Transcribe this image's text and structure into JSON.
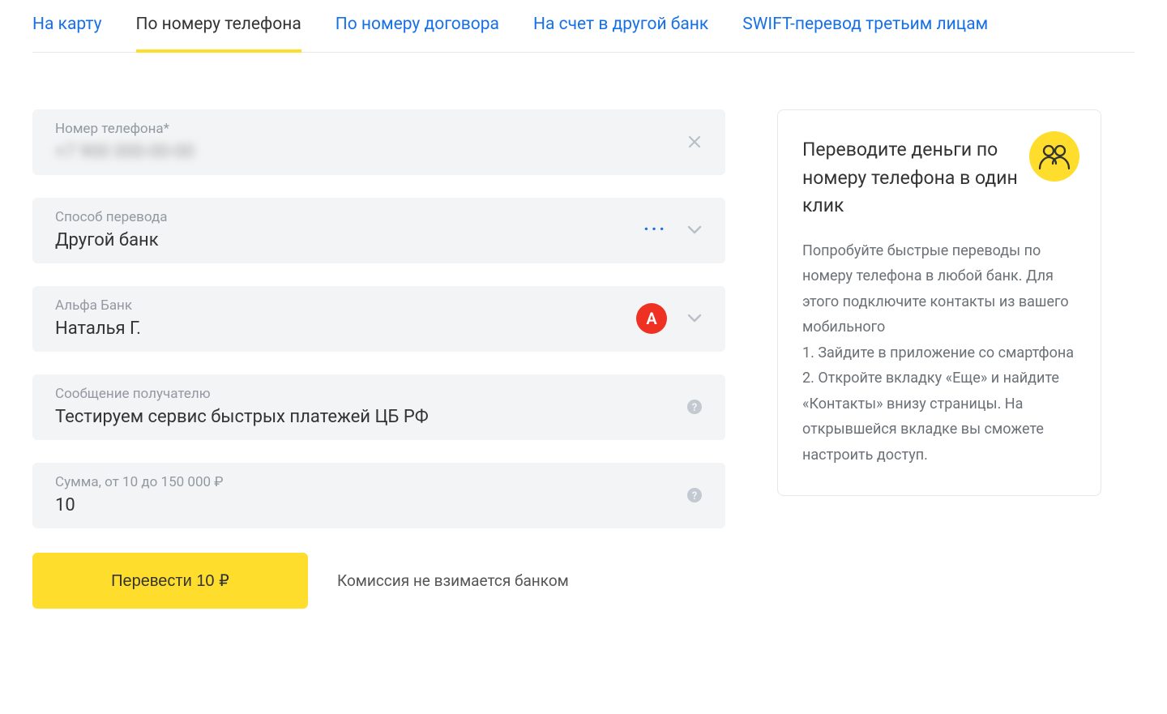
{
  "tabs": [
    {
      "label": "На карту"
    },
    {
      "label": "По номеру телефона",
      "active": true
    },
    {
      "label": "По номеру договора"
    },
    {
      "label": "На счет в другой банк"
    },
    {
      "label": "SWIFT-перевод третьим лицам"
    }
  ],
  "form": {
    "phone": {
      "label": "Номер телефона*",
      "value": "+7 900 000-00-00"
    },
    "method": {
      "label": "Способ перевода",
      "value": "Другой банк"
    },
    "bank": {
      "label": "Альфа Банк",
      "value": "Наталья Г.",
      "badge_letter": "A"
    },
    "message": {
      "label": "Сообщение получателю",
      "value": "Тестируем сервис быстрых платежей ЦБ РФ"
    },
    "amount": {
      "label": "Сумма, от 10 до 150 000 ₽",
      "value": "10"
    }
  },
  "submit_label": "Перевести 10 ₽",
  "commission_text": "Комиссия не взимается банком",
  "info": {
    "title": "Переводите деньги по номеру телефона в один клик",
    "body": "Попробуйте быстрые переводы по номеру телефона в любой банк. Для этого подключите контакты из вашего мобильного\n1.  Зайдите в приложение со смартфона\n2.  Откройте вкладку «Еще» и найдите «Контакты» внизу страницы. На открывшейся вкладке вы сможете настроить доступ."
  }
}
